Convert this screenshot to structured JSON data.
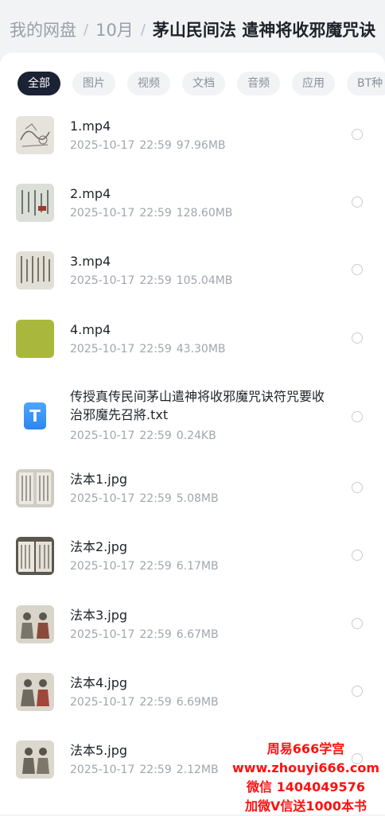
{
  "breadcrumb": {
    "root": "我的网盘",
    "folder": "10月",
    "current": "茅山民间法 遣神将收邪魔咒诀"
  },
  "tabs": [
    "全部",
    "图片",
    "视频",
    "文档",
    "音频",
    "应用",
    "BT种"
  ],
  "files": [
    {
      "name": "1.mp4",
      "date": "2025-10-17",
      "time": "22:59",
      "size": "97.96MB",
      "thumb": "sketch-icon"
    },
    {
      "name": "2.mp4",
      "date": "2025-10-17",
      "time": "22:59",
      "size": "128.60MB",
      "thumb": "script-icon"
    },
    {
      "name": "3.mp4",
      "date": "2025-10-17",
      "time": "22:59",
      "size": "105.04MB",
      "thumb": "script-icon"
    },
    {
      "name": "4.mp4",
      "date": "2025-10-17",
      "time": "22:59",
      "size": "43.30MB",
      "thumb": "green-icon"
    },
    {
      "name": "传授真传民间茅山遣神将收邪魔咒诀符咒要收治邪魔先召將.txt",
      "date": "2025-10-17",
      "time": "22:59",
      "size": "0.24KB",
      "thumb": "txt-icon"
    },
    {
      "name": "法本1.jpg",
      "date": "2025-10-17",
      "time": "22:59",
      "size": "5.08MB",
      "thumb": "book-icon"
    },
    {
      "name": "法本2.jpg",
      "date": "2025-10-17",
      "time": "22:59",
      "size": "6.17MB",
      "thumb": "book-icon"
    },
    {
      "name": "法本3.jpg",
      "date": "2025-10-17",
      "time": "22:59",
      "size": "6.67MB",
      "thumb": "figure-icon"
    },
    {
      "name": "法本4.jpg",
      "date": "2025-10-17",
      "time": "22:59",
      "size": "6.69MB",
      "thumb": "figure-icon"
    },
    {
      "name": "法本5.jpg",
      "date": "2025-10-17",
      "time": "22:59",
      "size": "2.12MB",
      "thumb": "figure-icon"
    }
  ],
  "watermark": {
    "line1": "周易666学宫",
    "line2": "www.zhouyi666.com",
    "line3": "微信 1404049576",
    "line4": "加微V信送1000本书"
  },
  "colors": {
    "active_tab": "#1b2233",
    "watermark": "#ff1010"
  }
}
